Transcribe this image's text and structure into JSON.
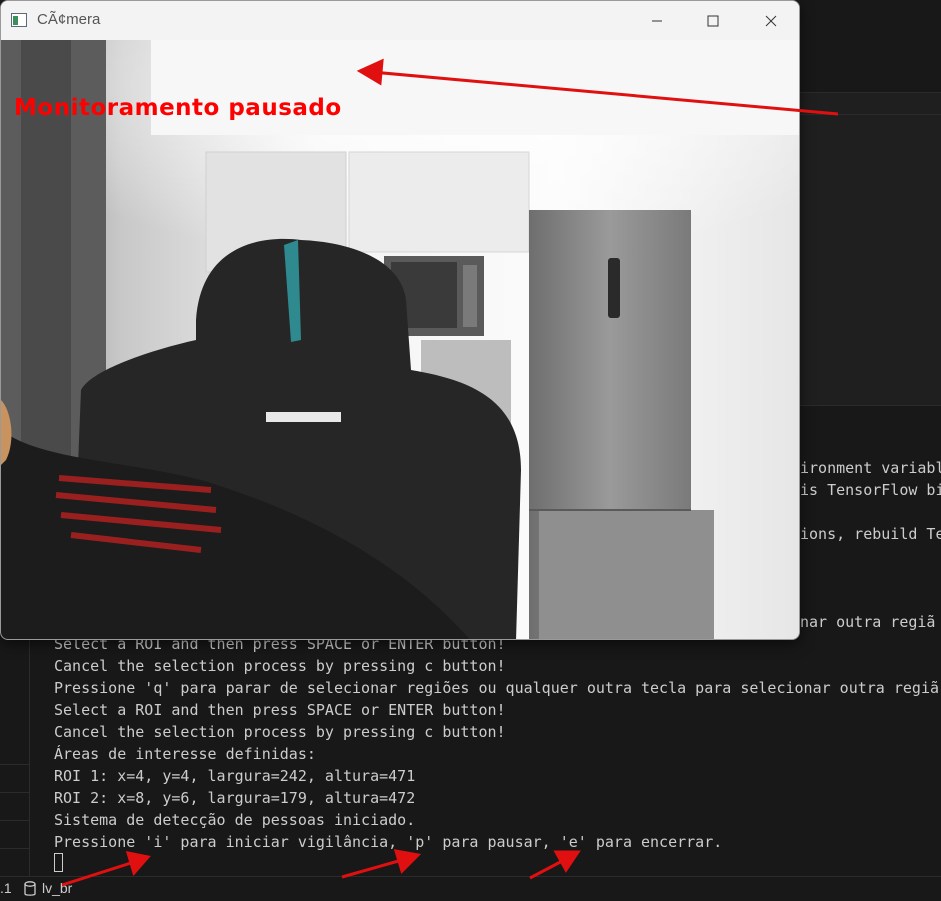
{
  "window": {
    "title": "CÃ¢mera",
    "overlay_text": "Monitoramento pausado"
  },
  "terminal": {
    "right_fragments": [
      "ironment variabl",
      "is TensorFlow bi",
      "ions, rebuild Te",
      "nar outra regiã"
    ],
    "lines": [
      "Select a ROI and then press SPACE or ENTER button!",
      "Cancel the selection process by pressing c button!",
      "Pressione 'q' para parar de selecionar regiões ou qualquer outra tecla para selecionar outra regiã",
      "Select a ROI and then press SPACE or ENTER button!",
      "Cancel the selection process by pressing c button!",
      "Áreas de interesse definidas:",
      "ROI 1: x=4, y=4, largura=242, altura=471",
      "ROI 2: x=8, y=6, largura=179, altura=472",
      "Sistema de detecção de pessoas iniciado.",
      "Pressione 'i' para iniciar vigilância, 'p' para pausar, 'e' para encerrar."
    ]
  },
  "status_bar": {
    "port_fragment": ".1",
    "branch": "lv_br"
  },
  "colors": {
    "overlay_red": "#ff0000",
    "annotation_arrow": "#e01010",
    "terminal_bg": "#181818",
    "terminal_text": "#cccccc"
  },
  "icons": [
    "app-icon",
    "minimize-icon",
    "maximize-icon",
    "close-icon",
    "database-icon"
  ]
}
